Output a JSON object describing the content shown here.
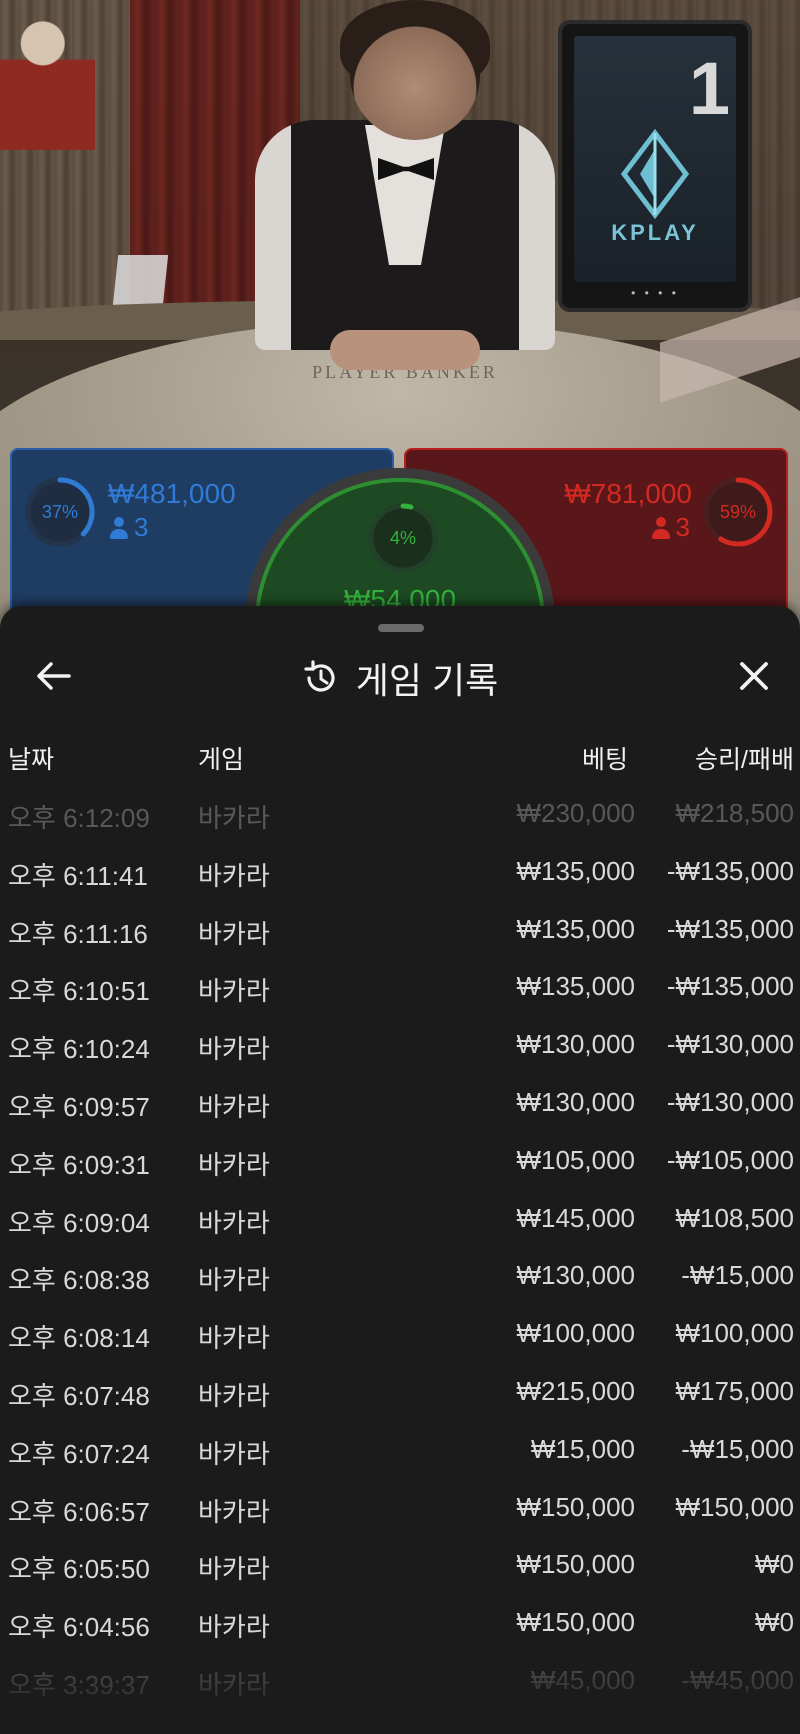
{
  "video": {
    "table_text": "PLAYER   BANKER",
    "monitor_number": "1",
    "monitor_brand": "KPLAY",
    "monitor_dots": "• • • •"
  },
  "bets": {
    "player": {
      "percent": "37%",
      "percent_value": 37,
      "amount": "₩481,000",
      "users": "3",
      "color": "#2f7bd6"
    },
    "banker": {
      "percent": "59%",
      "percent_value": 59,
      "amount": "₩781,000",
      "users": "3",
      "color": "#d22a22"
    },
    "tie": {
      "percent": "4%",
      "percent_value": 4,
      "amount": "₩54,000",
      "color": "#35b23c"
    }
  },
  "sheet": {
    "title": "게임 기록",
    "icons": {
      "back": "arrow-left-icon",
      "history": "history-icon",
      "close": "close-icon"
    },
    "columns": {
      "date": "날짜",
      "game": "게임",
      "bet": "베팅",
      "result": "승리/패배"
    },
    "rows": [
      {
        "date": "오후 6:12:09",
        "game": "바카라",
        "bet": "₩230,000",
        "result": "₩218,500"
      },
      {
        "date": "오후 6:11:41",
        "game": "바카라",
        "bet": "₩135,000",
        "result": "-₩135,000"
      },
      {
        "date": "오후 6:11:16",
        "game": "바카라",
        "bet": "₩135,000",
        "result": "-₩135,000"
      },
      {
        "date": "오후 6:10:51",
        "game": "바카라",
        "bet": "₩135,000",
        "result": "-₩135,000"
      },
      {
        "date": "오후 6:10:24",
        "game": "바카라",
        "bet": "₩130,000",
        "result": "-₩130,000"
      },
      {
        "date": "오후 6:09:57",
        "game": "바카라",
        "bet": "₩130,000",
        "result": "-₩130,000"
      },
      {
        "date": "오후 6:09:31",
        "game": "바카라",
        "bet": "₩105,000",
        "result": "-₩105,000"
      },
      {
        "date": "오후 6:09:04",
        "game": "바카라",
        "bet": "₩145,000",
        "result": "₩108,500"
      },
      {
        "date": "오후 6:08:38",
        "game": "바카라",
        "bet": "₩130,000",
        "result": "-₩15,000"
      },
      {
        "date": "오후 6:08:14",
        "game": "바카라",
        "bet": "₩100,000",
        "result": "₩100,000"
      },
      {
        "date": "오후 6:07:48",
        "game": "바카라",
        "bet": "₩215,000",
        "result": "₩175,000"
      },
      {
        "date": "오후 6:07:24",
        "game": "바카라",
        "bet": "₩15,000",
        "result": "-₩15,000"
      },
      {
        "date": "오후 6:06:57",
        "game": "바카라",
        "bet": "₩150,000",
        "result": "₩150,000"
      },
      {
        "date": "오후 6:05:50",
        "game": "바카라",
        "bet": "₩150,000",
        "result": "₩0"
      },
      {
        "date": "오후 6:04:56",
        "game": "바카라",
        "bet": "₩150,000",
        "result": "₩0"
      },
      {
        "date": "오후 3:39:37",
        "game": "바카라",
        "bet": "₩45,000",
        "result": "-₩45,000"
      }
    ]
  }
}
